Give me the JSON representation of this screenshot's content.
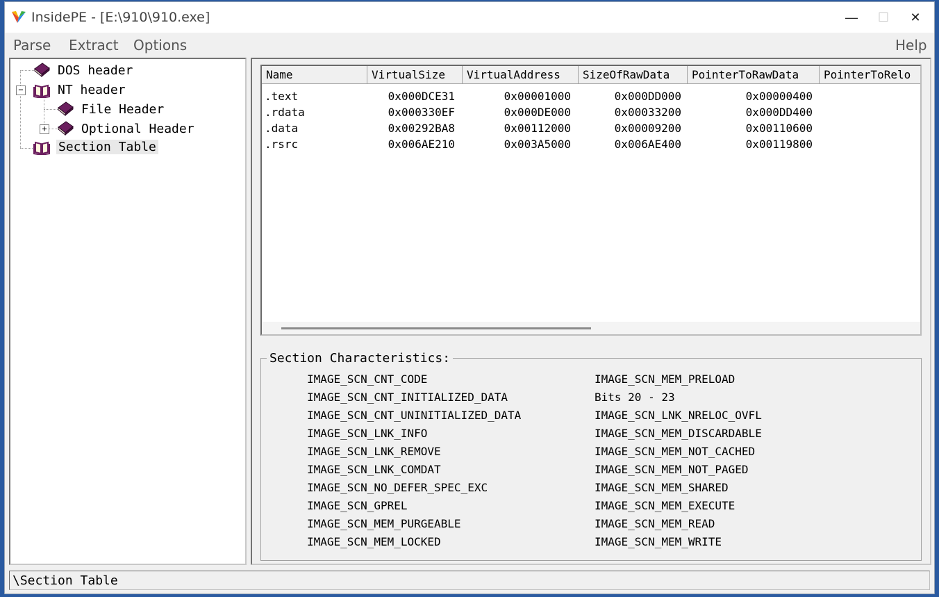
{
  "window": {
    "title": "InsidePE - [E:\\910\\910.exe]"
  },
  "titlebar_buttons": {
    "minimize": "—",
    "maximize": "☐",
    "close": "✕"
  },
  "menu": {
    "parse": "Parse",
    "extract": "Extract",
    "options": "Options",
    "help": "Help"
  },
  "tree": {
    "dos_header": "DOS header",
    "nt_header": "NT header",
    "file_header": "File Header",
    "optional_header": "Optional Header",
    "section_table": "Section Table",
    "collapse_glyph": "−",
    "expand_glyph": "+"
  },
  "table": {
    "columns": [
      "Name",
      "VirtualSize",
      "VirtualAddress",
      "SizeOfRawData",
      "PointerToRawData",
      "PointerToRelo"
    ],
    "rows": [
      [
        ".text",
        "0x000DCE31",
        "0x00001000",
        "0x000DD000",
        "0x00000400"
      ],
      [
        ".rdata",
        "0x000330EF",
        "0x000DE000",
        "0x00033200",
        "0x000DD400"
      ],
      [
        ".data",
        "0x00292BA8",
        "0x00112000",
        "0x00009200",
        "0x00110600"
      ],
      [
        ".rsrc",
        "0x006AE210",
        "0x003A5000",
        "0x006AE400",
        "0x00119800"
      ]
    ]
  },
  "characteristics": {
    "title": "Section Characteristics:",
    "left": [
      "IMAGE_SCN_CNT_CODE",
      "IMAGE_SCN_CNT_INITIALIZED_DATA",
      "IMAGE_SCN_CNT_UNINITIALIZED_DATA",
      "IMAGE_SCN_LNK_INFO",
      "IMAGE_SCN_LNK_REMOVE",
      "IMAGE_SCN_LNK_COMDAT",
      "IMAGE_SCN_NO_DEFER_SPEC_EXC",
      "IMAGE_SCN_GPREL",
      "IMAGE_SCN_MEM_PURGEABLE",
      "IMAGE_SCN_MEM_LOCKED"
    ],
    "right": [
      "IMAGE_SCN_MEM_PRELOAD",
      "Bits 20 - 23",
      "IMAGE_SCN_LNK_NRELOC_OVFL",
      "IMAGE_SCN_MEM_DISCARDABLE",
      "IMAGE_SCN_MEM_NOT_CACHED",
      "IMAGE_SCN_MEM_NOT_PAGED",
      "IMAGE_SCN_MEM_SHARED",
      "IMAGE_SCN_MEM_EXECUTE",
      "IMAGE_SCN_MEM_READ",
      "IMAGE_SCN_MEM_WRITE"
    ]
  },
  "status": {
    "text": "\\Section Table"
  },
  "colors": {
    "book": "#6b1f5e",
    "accent": "#2a5aa0"
  }
}
